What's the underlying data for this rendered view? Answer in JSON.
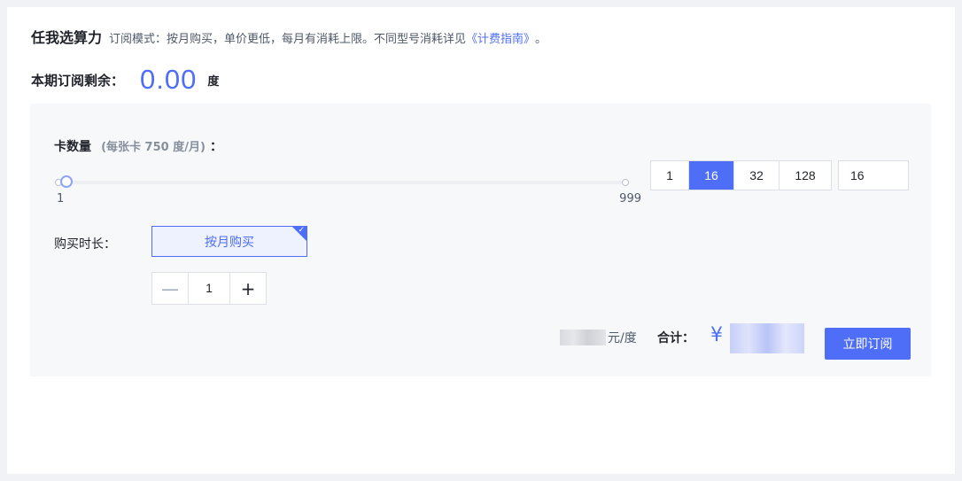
{
  "header": {
    "title": "任我选算力",
    "description": "订阅模式：按月购买，单价更低，每月有消耗上限。不同型号消耗详见",
    "guide_link": "《计费指南》",
    "tail": "。"
  },
  "remaining": {
    "label": "本期订阅剩余：",
    "value": "0.00",
    "unit": "度"
  },
  "card_quantity": {
    "label": "卡数量",
    "note": "(每张卡 750 度/月)",
    "colon": "：",
    "slider": {
      "min": "1",
      "max": "999",
      "value": 16
    },
    "presets": [
      "1",
      "16",
      "32",
      "128"
    ],
    "selected_preset": "16",
    "input_value": "16"
  },
  "duration": {
    "label": "购买时长：",
    "option": "按月购买",
    "stepper": {
      "minus": "—",
      "value": "1",
      "plus": "+"
    }
  },
  "summary": {
    "unit_price_suffix": "元/度",
    "total_label": "合计：",
    "currency": "¥",
    "subscribe_button": "立即订阅"
  },
  "colors": {
    "accent": "#4f6ef7",
    "panel_bg": "#f7f8fa"
  },
  "icons": {
    "check": "check-icon",
    "minus": "minus-icon",
    "plus": "plus-icon"
  }
}
